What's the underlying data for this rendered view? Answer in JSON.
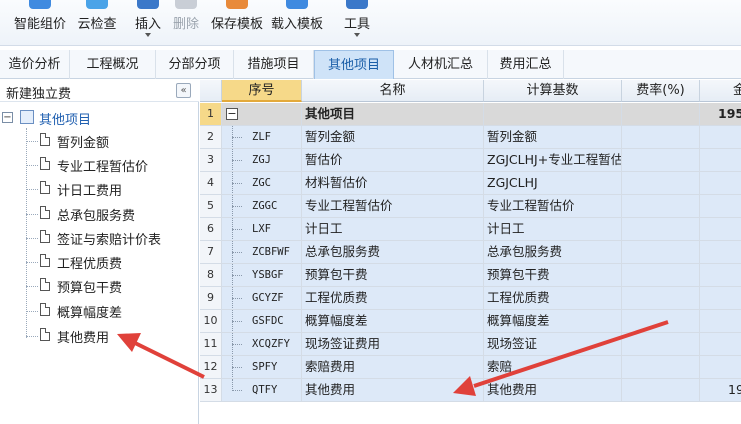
{
  "toolbar": {
    "items": [
      {
        "label": "智能组价",
        "icon": "smart-pricing-icon",
        "disabled": false,
        "caret": false
      },
      {
        "label": "云检查",
        "icon": "cloud-check-icon",
        "disabled": false,
        "caret": false
      },
      {
        "label": "插入",
        "icon": "insert-icon",
        "disabled": false,
        "caret": true
      },
      {
        "label": "删除",
        "icon": "delete-icon",
        "disabled": true,
        "caret": false
      },
      {
        "label": "保存模板",
        "icon": "save-template-icon",
        "disabled": false,
        "caret": false
      },
      {
        "label": "载入模板",
        "icon": "load-template-icon",
        "disabled": false,
        "caret": false
      },
      {
        "label": "工具",
        "icon": "tools-icon",
        "disabled": false,
        "caret": true
      }
    ]
  },
  "tabs": [
    {
      "label": "造价分析"
    },
    {
      "label": "工程概况"
    },
    {
      "label": "分部分项"
    },
    {
      "label": "措施项目"
    },
    {
      "label": "其他项目",
      "active": true
    },
    {
      "label": "人材机汇总"
    },
    {
      "label": "费用汇总"
    }
  ],
  "left_panel": {
    "title": "新建独立费",
    "collapse_glyph": "«",
    "root_label": "其他项目",
    "expander_glyph": "−",
    "items": [
      {
        "label": "暂列金额"
      },
      {
        "label": "专业工程暂估价"
      },
      {
        "label": "计日工费用"
      },
      {
        "label": "总承包服务费"
      },
      {
        "label": "签证与索赔计价表"
      },
      {
        "label": "工程优质费"
      },
      {
        "label": "预算包干费"
      },
      {
        "label": "概算幅度差"
      },
      {
        "label": "其他费用"
      }
    ]
  },
  "grid": {
    "headers": {
      "seq": "序号",
      "name": "名称",
      "basis": "计算基数",
      "rate": "费率(%)",
      "amount": "金"
    },
    "parent_row": {
      "rownum": "1",
      "expander": "−",
      "name": "其他项目",
      "amount": "195"
    },
    "rows": [
      {
        "rownum": "2",
        "code": "ZLF",
        "name": "暂列金额",
        "basis": "暂列金额",
        "amount": ""
      },
      {
        "rownum": "3",
        "code": "ZGJ",
        "name": "暂估价",
        "basis": "ZGJCLHJ+专业工程暂估价",
        "amount": ""
      },
      {
        "rownum": "4",
        "code": "ZGC",
        "name": "材料暂估价",
        "basis": "ZGJCLHJ",
        "amount": ""
      },
      {
        "rownum": "5",
        "code": "ZGGC",
        "name": "专业工程暂估价",
        "basis": "专业工程暂估价",
        "amount": ""
      },
      {
        "rownum": "6",
        "code": "LXF",
        "name": "计日工",
        "basis": "计日工",
        "amount": ""
      },
      {
        "rownum": "7",
        "code": "ZCBFWF",
        "name": "总承包服务费",
        "basis": "总承包服务费",
        "amount": ""
      },
      {
        "rownum": "8",
        "code": "YSBGF",
        "name": "预算包干费",
        "basis": "预算包干费",
        "amount": ""
      },
      {
        "rownum": "9",
        "code": "GCYZF",
        "name": "工程优质费",
        "basis": "工程优质费",
        "amount": ""
      },
      {
        "rownum": "10",
        "code": "GSFDC",
        "name": "概算幅度差",
        "basis": "概算幅度差",
        "amount": ""
      },
      {
        "rownum": "11",
        "code": "XCQZFY",
        "name": "现场签证费用",
        "basis": "现场签证",
        "amount": ""
      },
      {
        "rownum": "12",
        "code": "SPFY",
        "name": "索赔费用",
        "basis": "索赔",
        "amount": ""
      },
      {
        "rownum": "13",
        "code": "QTFY",
        "name": "其他费用",
        "basis": "其他费用",
        "amount": "19"
      }
    ]
  },
  "colors": {
    "annotation_arrow": "#e0413a",
    "active_tab": "#cfe3f8",
    "selected_header": "#f6d989"
  }
}
